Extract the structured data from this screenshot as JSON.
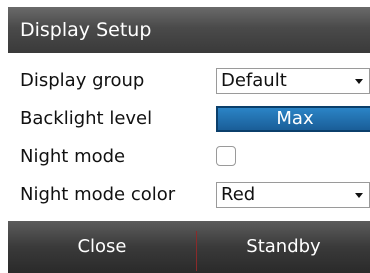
{
  "dialog": {
    "title": "Display Setup"
  },
  "settings": {
    "display_group": {
      "label": "Display group",
      "value": "Default"
    },
    "backlight": {
      "label": "Backlight level",
      "value": "Max"
    },
    "night_mode": {
      "label": "Night mode",
      "checked": false
    },
    "night_mode_color": {
      "label": "Night mode color",
      "value": "Red"
    }
  },
  "footer": {
    "close_label": "Close",
    "standby_label": "Standby"
  },
  "colors": {
    "accent": "#1f6fae",
    "title_bar": "#4a4a4a",
    "divider": "#8a2a2a"
  }
}
